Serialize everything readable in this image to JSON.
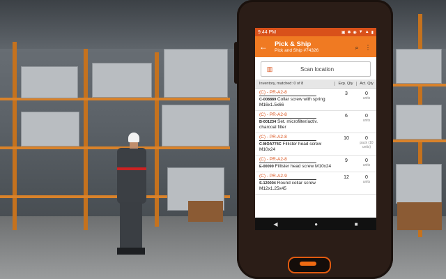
{
  "status_bar": {
    "time": "9:44 PM",
    "icons": [
      "▣",
      "✱",
      "◉",
      "▼",
      "▲",
      "▮"
    ]
  },
  "app_bar": {
    "back_icon": "←",
    "title": "Pick & Ship",
    "subtitle": "Pick and Ship #74326",
    "search_icon": "⌕",
    "menu_icon": "⋮"
  },
  "scan": {
    "icon": "▥",
    "label": "Scan location"
  },
  "table_header": {
    "inventory": "Inventory, matched: 0 of 8",
    "exp_qty": "Exp. Qty",
    "act_qty": "Act. Qty"
  },
  "rows": [
    {
      "location": "(C) - PR-A2-8",
      "sku": "C-008889",
      "description": " Collar screw with spring M16x1.5x66",
      "exp": "3",
      "act": "0",
      "units": "units"
    },
    {
      "location": "(C) - PR-A2-8",
      "sku": "B-001234",
      "description": " Set. microfilter/activ. charcoal filter",
      "exp": "6",
      "act": "0",
      "units": "units"
    },
    {
      "location": "(C) - PR-A2-8",
      "sku": "C-MOA774C",
      "description": " Fillister head screw M10x24",
      "exp": "10",
      "act": "0",
      "units": "pack (10 units)"
    },
    {
      "location": "(C) - PR-A2-8",
      "sku": "E-00099",
      "description": " Fillister head screw M10x24",
      "exp": "9",
      "act": "0",
      "units": "units"
    },
    {
      "location": "(C) - PR-A2-9",
      "sku": "S-120004",
      "description": " Round collar screw M12x1.25x45",
      "exp": "12",
      "act": "0",
      "units": "units"
    }
  ],
  "nav": {
    "back": "◀",
    "home": "●",
    "recents": "■"
  },
  "colors": {
    "accent": "#f07a22",
    "status": "#d9511a"
  }
}
